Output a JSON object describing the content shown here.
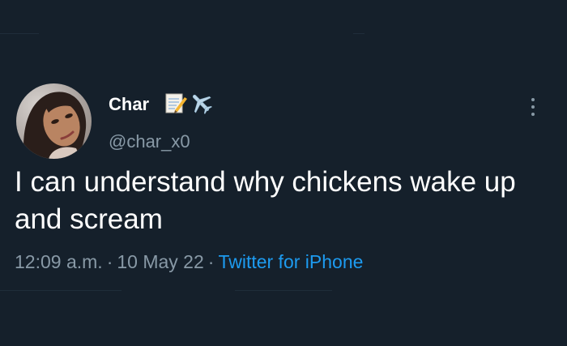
{
  "tweet": {
    "display_name": "Char",
    "name_emojis": [
      "memo-icon",
      "airplane-icon"
    ],
    "handle": "@char_x0",
    "text": "I can understand why chickens wake up and scream",
    "time": "12:09 a.m.",
    "date": "10 May 22",
    "separator": "·",
    "source": "Twitter for iPhone"
  },
  "colors": {
    "background": "#15202b",
    "primary_text": "#ffffff",
    "secondary_text": "#8899a6",
    "link": "#1d9bf0"
  }
}
